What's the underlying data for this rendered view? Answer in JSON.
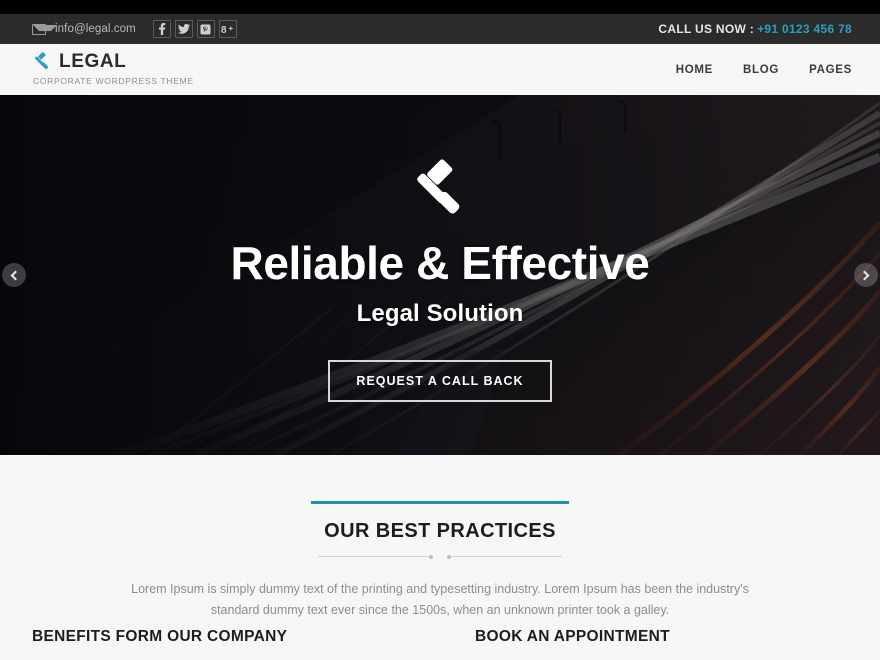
{
  "topbar": {
    "email": "info@legal.com",
    "mail_icon": "envelope-icon",
    "social": [
      {
        "name": "facebook-icon",
        "glyph": "f"
      },
      {
        "name": "twitter-icon",
        "glyph": "t"
      },
      {
        "name": "pinterest-icon",
        "glyph": "p"
      },
      {
        "name": "googleplus-icon",
        "glyph": "g"
      }
    ],
    "call_label": "CALL US NOW :",
    "phone": "+91 0123 456 78",
    "phone_color": "#2a9ec4",
    "background": "#2b2b2b"
  },
  "header": {
    "logo_icon": "gavel-icon",
    "brand": "LEGAL",
    "tagline": "CORPORATE WORDPRESS THEME",
    "accent_color": "#2a9ec4",
    "nav": [
      {
        "label": "HOME"
      },
      {
        "label": "BLOG"
      },
      {
        "label": "PAGES"
      }
    ]
  },
  "hero": {
    "icon": "gavel-icon",
    "title": "Reliable & Effective",
    "subtitle": "Legal Solution",
    "button_label": "REQUEST A CALL BACK",
    "prev_icon": "chevron-left-icon",
    "next_icon": "chevron-right-icon"
  },
  "practices": {
    "title": "OUR BEST PRACTICES",
    "rule_color": "#1f91a8",
    "description": "Lorem Ipsum is simply dummy text of the printing and typesetting industry. Lorem Ipsum has been the industry's standard dummy text ever since the 1500s, when an unknown printer took a galley."
  },
  "bottom_sections": {
    "left_title": "BENEFITS FORM OUR COMPANY",
    "right_title": "BOOK AN APPOINTMENT"
  }
}
